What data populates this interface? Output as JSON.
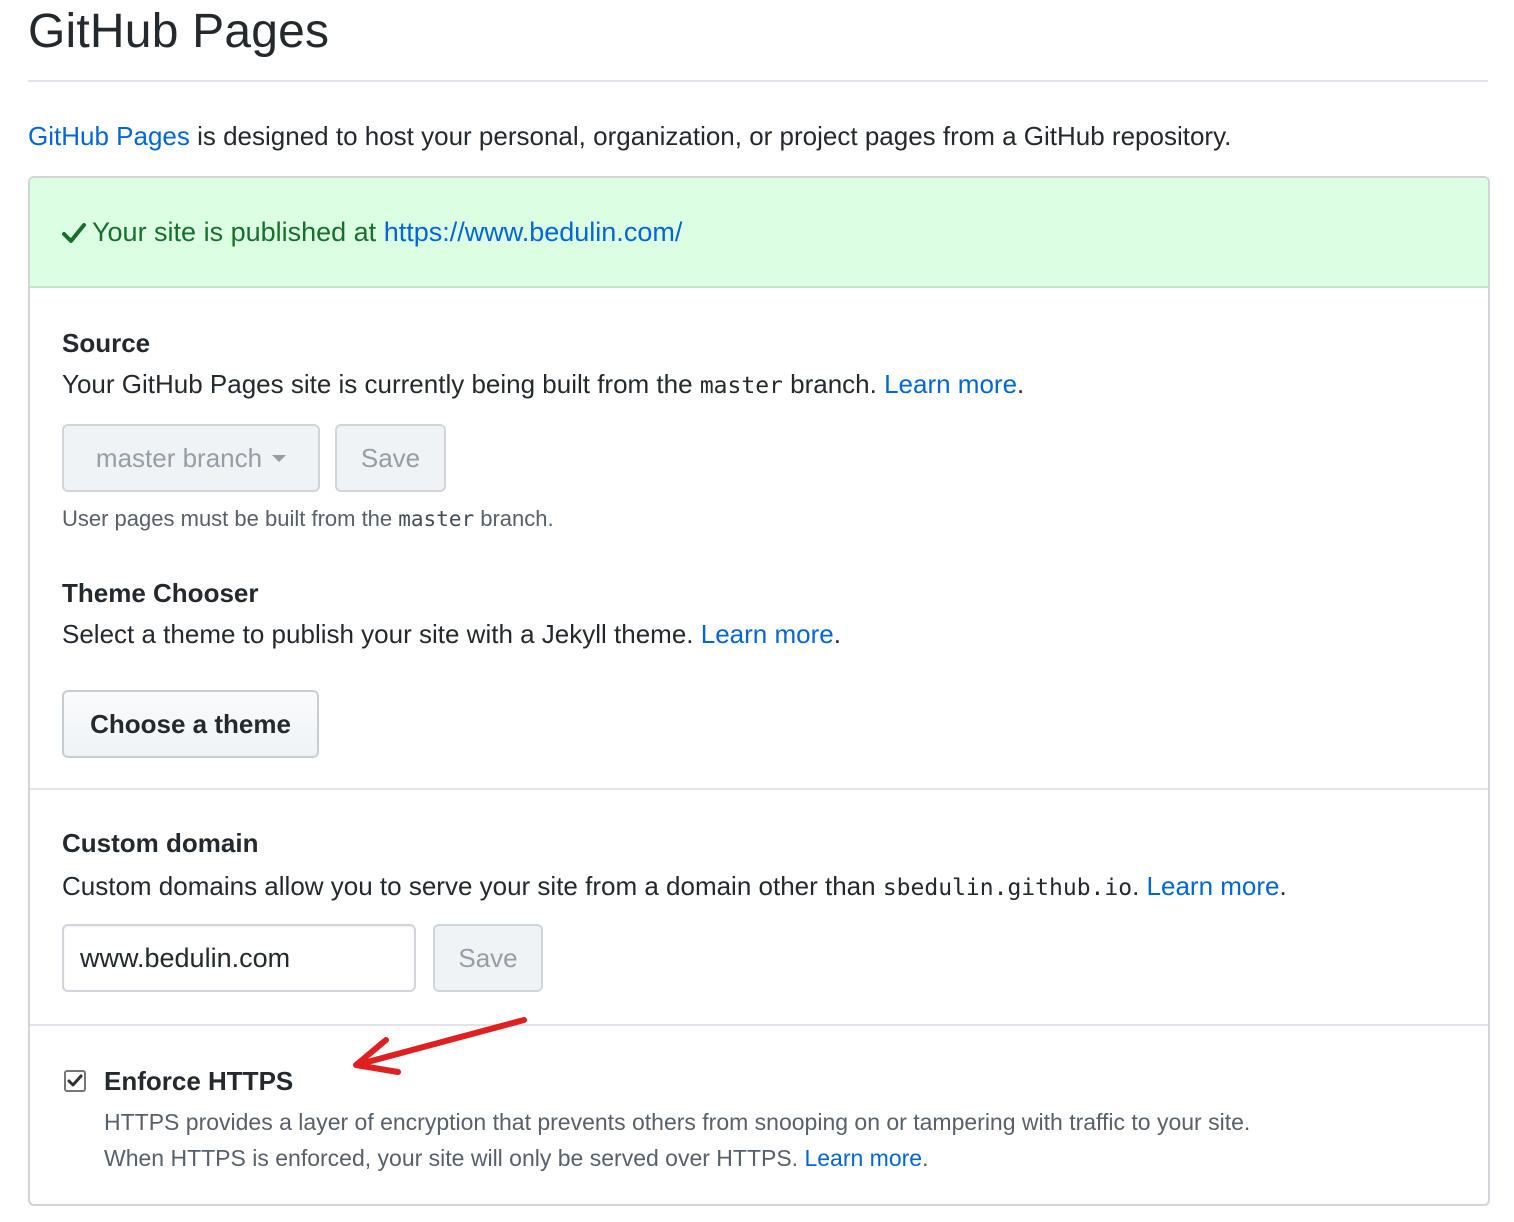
{
  "page": {
    "title": "GitHub Pages",
    "intro_link": "GitHub Pages",
    "intro_text": " is designed to host your personal, organization, or project pages from a GitHub repository."
  },
  "banner": {
    "icon": "check-icon",
    "text": "Your site is published at ",
    "url": "https://www.bedulin.com/"
  },
  "source": {
    "heading": "Source",
    "desc_before": "Your GitHub Pages site is currently being built from the ",
    "desc_code": "master",
    "desc_after": " branch. ",
    "learn_more": "Learn more",
    "learn_more_suffix": ".",
    "branch_select": "master branch",
    "save_label": "Save",
    "note_before": "User pages must be built from the ",
    "note_code": "master",
    "note_after": " branch."
  },
  "theme": {
    "heading": "Theme Chooser",
    "desc": "Select a theme to publish your site with a Jekyll theme. ",
    "learn_more": "Learn more",
    "learn_more_suffix": ".",
    "button": "Choose a theme"
  },
  "custom_domain": {
    "heading": "Custom domain",
    "desc_before": "Custom domains allow you to serve your site from a domain other than ",
    "desc_code": "sbedulin.github.io",
    "desc_after": ". ",
    "learn_more": "Learn more",
    "learn_more_suffix": ".",
    "input_value": "www.bedulin.com",
    "save_label": "Save"
  },
  "https": {
    "checked": true,
    "label": "Enforce HTTPS",
    "line1": "HTTPS provides a layer of encryption that prevents others from snooping on or tampering with traffic to your site.",
    "line2": "When HTTPS is enforced, your site will only be served over HTTPS. ",
    "learn_more": "Learn more",
    "learn_more_suffix": "."
  },
  "colors": {
    "link": "#0366d6",
    "success_bg": "#dcffe4",
    "success_text": "#176f2c",
    "annotation_arrow": "#e02020"
  }
}
